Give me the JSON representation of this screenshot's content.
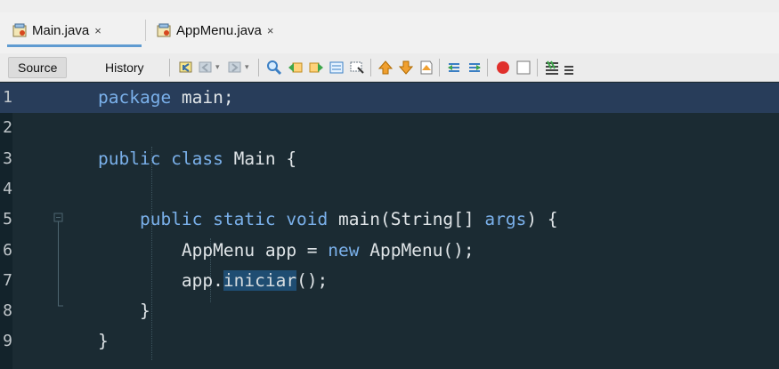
{
  "tabs": [
    {
      "label": "Main.java",
      "close": "×"
    },
    {
      "label": "AppMenu.java",
      "close": "×"
    }
  ],
  "toolbar": {
    "source_label": "Source",
    "history_label": "History"
  },
  "editor": {
    "lines": [
      {
        "num": "1",
        "parts": [
          {
            "cls": "kw",
            "t": "package "
          },
          {
            "cls": "ty",
            "t": "main;"
          }
        ]
      },
      {
        "num": "2",
        "parts": []
      },
      {
        "num": "3",
        "parts": [
          {
            "cls": "kw",
            "t": "public class "
          },
          {
            "cls": "ty",
            "t": "Main {"
          }
        ]
      },
      {
        "num": "4",
        "parts": []
      },
      {
        "num": "5",
        "parts": [
          {
            "cls": "kw",
            "t": "    public static void "
          },
          {
            "cls": "ty",
            "t": "main(String[] "
          },
          {
            "cls": "kw",
            "t": "args"
          },
          {
            "cls": "ty",
            "t": ") {"
          }
        ]
      },
      {
        "num": "6",
        "parts": [
          {
            "cls": "ty",
            "t": "        AppMenu app = "
          },
          {
            "cls": "kw",
            "t": "new "
          },
          {
            "cls": "ty",
            "t": "AppMenu();"
          }
        ]
      },
      {
        "num": "7",
        "parts": [
          {
            "cls": "ty",
            "t": "        app."
          },
          {
            "cls": "sel",
            "t": "iniciar"
          },
          {
            "cls": "ty",
            "t": "();"
          }
        ]
      },
      {
        "num": "8",
        "parts": [
          {
            "cls": "ty",
            "t": "    }"
          }
        ]
      },
      {
        "num": "9",
        "parts": [
          {
            "cls": "ty",
            "t": "}"
          }
        ]
      }
    ]
  },
  "colors": {
    "editor_bg": "#1b2b33",
    "keyword": "#7ab0ea",
    "current_line": "#283d5a"
  }
}
